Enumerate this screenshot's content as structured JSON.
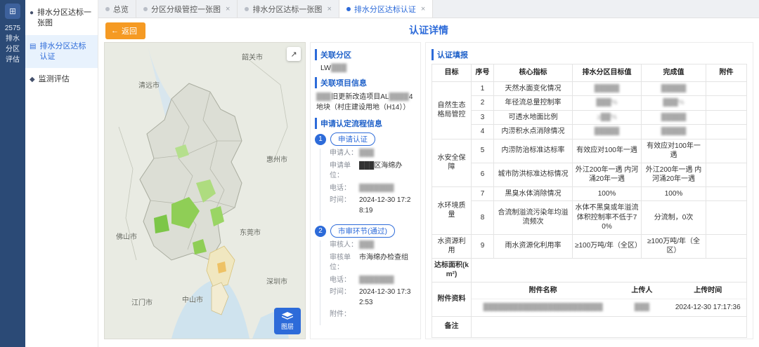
{
  "rail": {
    "title": "2575排水分区评估"
  },
  "sidebar": {
    "items": [
      {
        "label": "排水分区达标一张图"
      },
      {
        "label": "排水分区达标认证"
      },
      {
        "label": "监测评估"
      }
    ]
  },
  "tabs": {
    "close": "×",
    "items": [
      {
        "label": "总览"
      },
      {
        "label": "分区分级管控一张图"
      },
      {
        "label": "排水分区达标一张图"
      },
      {
        "label": "排水分区达标认证"
      }
    ]
  },
  "header": {
    "back": "返回",
    "title": "认证详情"
  },
  "map": {
    "cities": [
      "韶关市",
      "清远市",
      "惠州市",
      "佛山市",
      "东莞市",
      "深圳市",
      "江门市",
      "中山市"
    ],
    "expand": "↗",
    "layer_button": "图层"
  },
  "info": {
    "related_zone_title": "关联分区",
    "related_zone_prefix": "LW",
    "related_zone_mask": "███",
    "related_project_title": "关联项目信息",
    "related_project_parts": [
      {
        "text": "███"
      },
      {
        "text": "旧更新改造项目AL"
      },
      {
        "text": "████"
      },
      {
        "text": "4地块"
      },
      {
        "text": "（村庄建设用地（H14））"
      }
    ],
    "process_title": "申请认定流程信息",
    "steps": [
      {
        "no": "1",
        "name": "申请认证",
        "fields": [
          {
            "label": "申请人：",
            "value": "███"
          },
          {
            "label": "申请单位：",
            "value": "███区海绵办"
          },
          {
            "label": "电话：",
            "value": "███████"
          },
          {
            "label": "时间：",
            "value": "2024-12-30 17:28:19"
          }
        ]
      },
      {
        "no": "2",
        "name": "市审环节(通过)",
        "fields": [
          {
            "label": "审核人：",
            "value": "███"
          },
          {
            "label": "审核单位：",
            "value": "市海绵办检查组"
          },
          {
            "label": "电话：",
            "value": "███████"
          },
          {
            "label": "时间：",
            "value": "2024-12-30 17:32:53"
          },
          {
            "label": "附件：",
            "value": ""
          }
        ]
      }
    ]
  },
  "cert": {
    "title": "认证填报",
    "columns": [
      "目标",
      "序号",
      "核心指标",
      "排水分区目标值",
      "完成值",
      "附件"
    ],
    "groups": [
      {
        "name": "自然生态格局管控"
      },
      {
        "name": "水安全保障"
      },
      {
        "name": "水环境质量"
      },
      {
        "name": "水资源利用"
      }
    ],
    "rows": [
      {
        "no": "1",
        "indicator": "天然水面变化情况",
        "target": "█████",
        "done": "█████"
      },
      {
        "no": "2",
        "indicator": "年径流总量控制率",
        "target": "███%",
        "done": "███%"
      },
      {
        "no": "3",
        "indicator": "可透水地面比例",
        "target": "≥██%",
        "done": "█████"
      },
      {
        "no": "4",
        "indicator": "内涝积水点消除情况",
        "target": "█████",
        "done": "█████"
      },
      {
        "no": "5",
        "indicator": "内涝防治标准达标率",
        "target": "有效应对100年一遇",
        "done": "有效应对100年一遇"
      },
      {
        "no": "6",
        "indicator": "城市防洪标准达标情况",
        "target": "外江200年一遇 内河涌20年一遇",
        "done": "外江200年一遇 内河涌20年一遇"
      },
      {
        "no": "7",
        "indicator": "黑臭水体消除情况",
        "target": "100%",
        "done": "100%"
      },
      {
        "no": "8",
        "indicator": "合流制溢流污染年均溢流频次",
        "target": "水体不黑臭或年溢流体积控制率不低于70%",
        "done": "分流制，0次"
      },
      {
        "no": "9",
        "indicator": "雨水资源化利用率",
        "target": "≥100万吨/年（全区）",
        "done": "≥100万吨/年（全区）"
      }
    ],
    "footer": {
      "area_label": "达标面积(km²)",
      "attachments_label": "附件资料",
      "attachments_columns": [
        "附件名称",
        "上传人",
        "上传时间"
      ],
      "attachments_rows": [
        {
          "name": "████████████████████████",
          "uploader": "███",
          "time": "2024-12-30 17:17:36"
        }
      ],
      "remark_label": "备注"
    }
  }
}
